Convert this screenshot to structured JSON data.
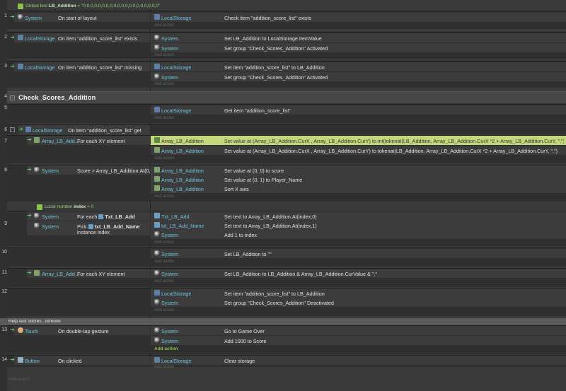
{
  "global": {
    "text": "Global text ",
    "name": "LB_Addition",
    "value": " = \"0,0,0,0,0,0,0,0,0,0,0,0,0,0,0,0,0,0,0,0\""
  },
  "events": [
    {
      "num": "1",
      "cond_obj": "System",
      "cond_text": "On start of layout",
      "actions": [
        {
          "obj": "LocalStorage",
          "text": "Check item \"addition_score_list\" exists"
        }
      ]
    },
    {
      "num": "2",
      "cond_obj": "LocalStorage",
      "cond_text": "On item \"addition_score_list\" exists",
      "actions": [
        {
          "obj": "System",
          "text": "Set LB_Addition to LocalStorage.ItemValue"
        },
        {
          "obj": "System",
          "text": "Set group \"Check_Scores_Addition\" Activated"
        }
      ]
    },
    {
      "num": "3",
      "cond_obj": "LocalStorage",
      "cond_text": "On item \"addition_score_list\" missing",
      "actions": [
        {
          "obj": "LocalStorage",
          "text": "Set item \"addition_score_list\" to LB_Addition"
        },
        {
          "obj": "System",
          "text": "Set group \"Check_Scores_Addition\" Activated"
        }
      ]
    }
  ],
  "group": {
    "num": "4",
    "title": "Check_Scores_Addition"
  },
  "e5": {
    "num": "5",
    "obj": "LocalStorage",
    "text": "Get item \"addition_score_list\""
  },
  "e6": {
    "num": "6",
    "cond_obj": "LocalStorage",
    "cond_text": "On item \"addition_score_list\" get"
  },
  "e7": {
    "num": "7",
    "cond_obj": "Array_LB_Add...",
    "cond_text": "For each XY element",
    "a1_obj": "Array_LB_Addition",
    "a1_text": "Set value at (Array_LB_Addition.CurX , Array_LB_Addition.CurY) to int(tokenat(LB_Addition, Array_LB_Addition.CurX *2 + Array_LB_Addition.CurY, \",\"))",
    "a2_obj": "Array_LB_Addition",
    "a2_text": "Set value at (Array_LB_Addition.CurX , Array_LB_Addition.CurY) to tokenat(LB_Addition, Array_LB_Addition.CurX *2 + Array_LB_Addition.CurY, \",\")"
  },
  "e8": {
    "num": "8",
    "cond_obj": "System",
    "cond_text": "Score > Array_LB_Addition.At(0,0)",
    "actions": [
      {
        "obj": "Array_LB_Addition",
        "text": "Set value at (0, 0) to score"
      },
      {
        "obj": "Array_LB_Addition",
        "text": "Set value at (0, 1) to Player_Name"
      },
      {
        "obj": "Array_LB_Addition",
        "text": "Sort X axis"
      }
    ]
  },
  "localvar": {
    "text": "Local number ",
    "name": "index",
    "value": " = 0"
  },
  "e9": {
    "num": "9",
    "c1_obj": "System",
    "c1_text": "For each ",
    "c1_obj2": "Txt_LB_Add",
    "c2_obj": "System",
    "c2_text": "Pick ",
    "c2_obj2": "txt_LB_Add_Name",
    "c2_text2": "instance index",
    "actions": [
      {
        "obj": "Txt_LB_Add",
        "text": "Set text to Array_LB_Addition.At(index,0)"
      },
      {
        "obj": "txt_LB_Add_Name",
        "text": "Set text to Array_LB_Addition.At(index,1)"
      },
      {
        "obj": "System",
        "text": "Add 1 to index"
      }
    ]
  },
  "e10": {
    "num": "10",
    "obj": "System",
    "text": "Set LB_Addition to \"\""
  },
  "e11": {
    "num": "11",
    "cond_obj": "Array_LB_Add...",
    "cond_text": "For each XY element",
    "obj": "System",
    "text": "Set LB_Addition to LB_Addition & Array_LB_Addition.CurValue & \",\""
  },
  "e12": {
    "num": "12",
    "actions": [
      {
        "obj": "LocalStorage",
        "text": "Set item \"addition_score_list\" to LB_Addition"
      },
      {
        "obj": "System",
        "text": "Set group \"Check_Scores_Addition\" Deactivated"
      }
    ]
  },
  "comment": "Help test socres...remove",
  "e13": {
    "num": "13",
    "cond_obj": "Touch",
    "cond_text": "On double-tap gesture",
    "actions": [
      {
        "obj": "System",
        "text": "Go to Game Over"
      },
      {
        "obj": "System",
        "text": "Add 1000 to Score"
      }
    ],
    "add_action": "Add action"
  },
  "e14": {
    "num": "14",
    "cond_obj": "Button",
    "cond_text": "On clicked",
    "obj": "LocalStorage",
    "text": "Clear storage"
  },
  "add_action_label": "Add action",
  "add_event": "Add event"
}
